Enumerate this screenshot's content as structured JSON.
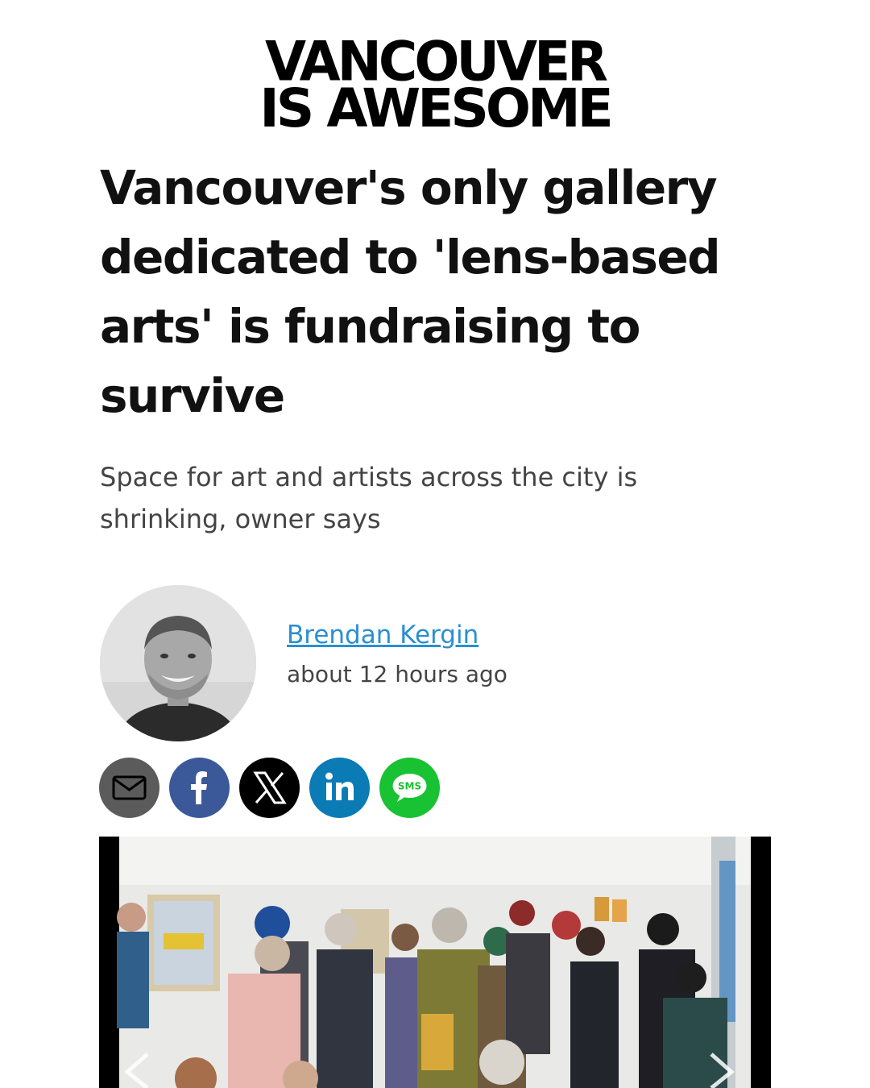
{
  "logo": {
    "line1": "VANCOUVER",
    "line2": "IS AWESOME"
  },
  "article": {
    "headline": "Vancouver's only gallery dedicated to 'lens-based arts' is fundraising to survive",
    "subheadline": "Space for art and artists across the city is shrinking, owner says"
  },
  "byline": {
    "author": "Brendan Kergin",
    "timestamp": "about 12 hours ago"
  },
  "share": {
    "buttons": [
      {
        "icon": "email-icon",
        "color": "#5b5b5b"
      },
      {
        "icon": "facebook-icon",
        "label": "f",
        "color": "#3b5998"
      },
      {
        "icon": "x-icon",
        "color": "#000000"
      },
      {
        "icon": "linkedin-icon",
        "label": "in",
        "color": "#0a7bb5"
      },
      {
        "icon": "sms-icon",
        "label": "SMS",
        "color": "#18c232"
      }
    ]
  },
  "colors": {
    "link": "#2a8fd0",
    "headline": "#111111",
    "body": "#444444"
  }
}
